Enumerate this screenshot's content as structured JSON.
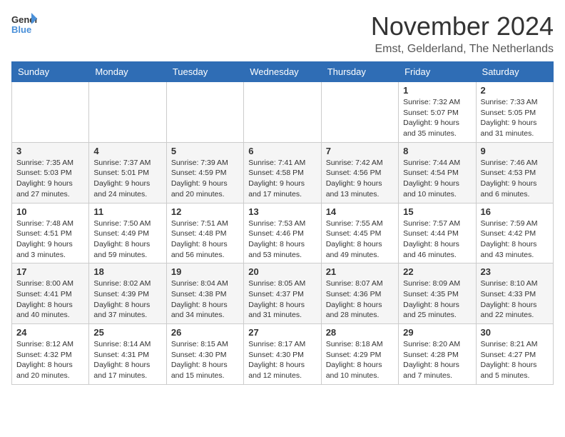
{
  "logo": {
    "general": "General",
    "blue": "Blue"
  },
  "title": "November 2024",
  "location": "Emst, Gelderland, The Netherlands",
  "headers": [
    "Sunday",
    "Monday",
    "Tuesday",
    "Wednesday",
    "Thursday",
    "Friday",
    "Saturday"
  ],
  "rows": [
    [
      {
        "day": "",
        "info": ""
      },
      {
        "day": "",
        "info": ""
      },
      {
        "day": "",
        "info": ""
      },
      {
        "day": "",
        "info": ""
      },
      {
        "day": "",
        "info": ""
      },
      {
        "day": "1",
        "info": "Sunrise: 7:32 AM\nSunset: 5:07 PM\nDaylight: 9 hours and 35 minutes."
      },
      {
        "day": "2",
        "info": "Sunrise: 7:33 AM\nSunset: 5:05 PM\nDaylight: 9 hours and 31 minutes."
      }
    ],
    [
      {
        "day": "3",
        "info": "Sunrise: 7:35 AM\nSunset: 5:03 PM\nDaylight: 9 hours and 27 minutes."
      },
      {
        "day": "4",
        "info": "Sunrise: 7:37 AM\nSunset: 5:01 PM\nDaylight: 9 hours and 24 minutes."
      },
      {
        "day": "5",
        "info": "Sunrise: 7:39 AM\nSunset: 4:59 PM\nDaylight: 9 hours and 20 minutes."
      },
      {
        "day": "6",
        "info": "Sunrise: 7:41 AM\nSunset: 4:58 PM\nDaylight: 9 hours and 17 minutes."
      },
      {
        "day": "7",
        "info": "Sunrise: 7:42 AM\nSunset: 4:56 PM\nDaylight: 9 hours and 13 minutes."
      },
      {
        "day": "8",
        "info": "Sunrise: 7:44 AM\nSunset: 4:54 PM\nDaylight: 9 hours and 10 minutes."
      },
      {
        "day": "9",
        "info": "Sunrise: 7:46 AM\nSunset: 4:53 PM\nDaylight: 9 hours and 6 minutes."
      }
    ],
    [
      {
        "day": "10",
        "info": "Sunrise: 7:48 AM\nSunset: 4:51 PM\nDaylight: 9 hours and 3 minutes."
      },
      {
        "day": "11",
        "info": "Sunrise: 7:50 AM\nSunset: 4:49 PM\nDaylight: 8 hours and 59 minutes."
      },
      {
        "day": "12",
        "info": "Sunrise: 7:51 AM\nSunset: 4:48 PM\nDaylight: 8 hours and 56 minutes."
      },
      {
        "day": "13",
        "info": "Sunrise: 7:53 AM\nSunset: 4:46 PM\nDaylight: 8 hours and 53 minutes."
      },
      {
        "day": "14",
        "info": "Sunrise: 7:55 AM\nSunset: 4:45 PM\nDaylight: 8 hours and 49 minutes."
      },
      {
        "day": "15",
        "info": "Sunrise: 7:57 AM\nSunset: 4:44 PM\nDaylight: 8 hours and 46 minutes."
      },
      {
        "day": "16",
        "info": "Sunrise: 7:59 AM\nSunset: 4:42 PM\nDaylight: 8 hours and 43 minutes."
      }
    ],
    [
      {
        "day": "17",
        "info": "Sunrise: 8:00 AM\nSunset: 4:41 PM\nDaylight: 8 hours and 40 minutes."
      },
      {
        "day": "18",
        "info": "Sunrise: 8:02 AM\nSunset: 4:39 PM\nDaylight: 8 hours and 37 minutes."
      },
      {
        "day": "19",
        "info": "Sunrise: 8:04 AM\nSunset: 4:38 PM\nDaylight: 8 hours and 34 minutes."
      },
      {
        "day": "20",
        "info": "Sunrise: 8:05 AM\nSunset: 4:37 PM\nDaylight: 8 hours and 31 minutes."
      },
      {
        "day": "21",
        "info": "Sunrise: 8:07 AM\nSunset: 4:36 PM\nDaylight: 8 hours and 28 minutes."
      },
      {
        "day": "22",
        "info": "Sunrise: 8:09 AM\nSunset: 4:35 PM\nDaylight: 8 hours and 25 minutes."
      },
      {
        "day": "23",
        "info": "Sunrise: 8:10 AM\nSunset: 4:33 PM\nDaylight: 8 hours and 22 minutes."
      }
    ],
    [
      {
        "day": "24",
        "info": "Sunrise: 8:12 AM\nSunset: 4:32 PM\nDaylight: 8 hours and 20 minutes."
      },
      {
        "day": "25",
        "info": "Sunrise: 8:14 AM\nSunset: 4:31 PM\nDaylight: 8 hours and 17 minutes."
      },
      {
        "day": "26",
        "info": "Sunrise: 8:15 AM\nSunset: 4:30 PM\nDaylight: 8 hours and 15 minutes."
      },
      {
        "day": "27",
        "info": "Sunrise: 8:17 AM\nSunset: 4:30 PM\nDaylight: 8 hours and 12 minutes."
      },
      {
        "day": "28",
        "info": "Sunrise: 8:18 AM\nSunset: 4:29 PM\nDaylight: 8 hours and 10 minutes."
      },
      {
        "day": "29",
        "info": "Sunrise: 8:20 AM\nSunset: 4:28 PM\nDaylight: 8 hours and 7 minutes."
      },
      {
        "day": "30",
        "info": "Sunrise: 8:21 AM\nSunset: 4:27 PM\nDaylight: 8 hours and 5 minutes."
      }
    ]
  ]
}
